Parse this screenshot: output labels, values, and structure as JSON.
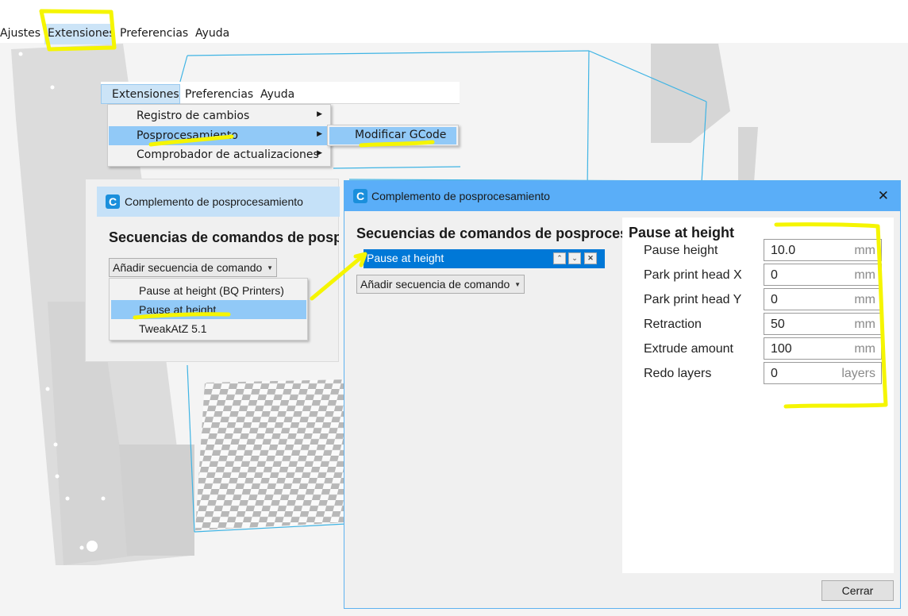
{
  "top_menu": {
    "ajustes": "Ajustes",
    "extensiones": "Extensiones",
    "preferencias": "Preferencias",
    "ayuda": "Ayuda"
  },
  "inset_menu": {
    "extensiones": "Extensiones",
    "preferencias": "Preferencias",
    "ayuda": "Ayuda",
    "items": [
      {
        "label": "Registro de cambios"
      },
      {
        "label": "Posprocesamiento"
      },
      {
        "label": "Comprobador de actualizaciones"
      }
    ],
    "submenu_label": "Modificar GCode"
  },
  "small_dialog": {
    "title": "Complemento de posprocesamiento",
    "heading": "Secuencias de comandos de posprocesamiento",
    "combo": "Añadir secuencia de comando",
    "options": [
      {
        "label": "Pause at height (BQ Printers)"
      },
      {
        "label": "Pause at height"
      },
      {
        "label": "TweakAtZ 5.1"
      }
    ]
  },
  "main_dialog": {
    "title": "Complemento de posprocesamiento",
    "heading": "Secuencias de comandos de posprocesamiento",
    "script_item": "Pause at height",
    "combo": "Añadir secuencia de comando",
    "settings_title": "Pause at height",
    "settings": [
      {
        "label": "Pause height",
        "value": "10.0",
        "unit": "mm"
      },
      {
        "label": "Park print head X",
        "value": "0",
        "unit": "mm"
      },
      {
        "label": "Park print head Y",
        "value": "0",
        "unit": "mm"
      },
      {
        "label": "Retraction",
        "value": "50",
        "unit": "mm"
      },
      {
        "label": "Extrude amount",
        "value": "100",
        "unit": "mm"
      },
      {
        "label": "Redo layers",
        "value": "0",
        "unit": "layers"
      }
    ],
    "close_button": "Cerrar"
  },
  "colors": {
    "title_bar": "#5aaef8",
    "selection": "#0078d7",
    "menu_highlight": "#91c9f7",
    "annotation": "#f5f500",
    "frame_lines": "#3fb4e4"
  }
}
